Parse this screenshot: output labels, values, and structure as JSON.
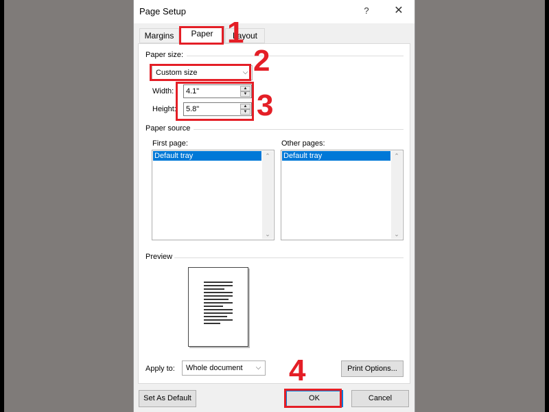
{
  "dialog": {
    "title": "Page Setup",
    "help_glyph": "?",
    "close_glyph": "✕"
  },
  "tabs": [
    {
      "label": "Margins"
    },
    {
      "label": "Paper"
    },
    {
      "label": "Layout"
    }
  ],
  "paper_size": {
    "group_label": "Paper size:",
    "selected": "Custom size",
    "width_label": "Width:",
    "width_value": "4.1\"",
    "height_label": "Height:",
    "height_value": "5.8\""
  },
  "paper_source": {
    "group_label": "Paper source",
    "first_page_label": "First page:",
    "first_page_selected": "Default tray",
    "other_pages_label": "Other pages:",
    "other_pages_selected": "Default tray"
  },
  "preview": {
    "group_label": "Preview"
  },
  "apply_to": {
    "label": "Apply to:",
    "selected": "Whole document"
  },
  "buttons": {
    "print_options": "Print Options...",
    "set_default": "Set As Default",
    "ok": "OK",
    "cancel": "Cancel"
  },
  "annotations": {
    "step1": "1",
    "step2": "2",
    "step3": "3",
    "step4": "4"
  },
  "colors": {
    "annotation_red": "#e41e26",
    "selection_blue": "#0078d7",
    "backdrop": "#7f7b79"
  }
}
